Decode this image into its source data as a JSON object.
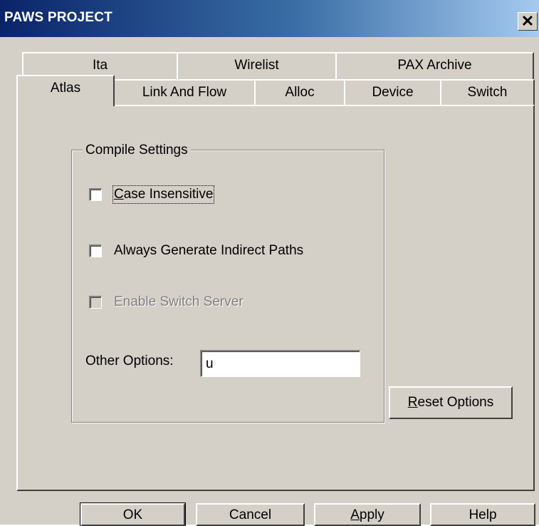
{
  "window": {
    "title": "PAWS PROJECT",
    "close_glyph": "✕",
    "close_icon": "close-icon"
  },
  "tabs": {
    "back_row": [
      "Ita",
      "Wirelist",
      "PAX Archive"
    ],
    "front_row": [
      "Atlas",
      "Link And Flow",
      "Alloc",
      "Device",
      "Switch"
    ],
    "active": "Atlas"
  },
  "compile_settings": {
    "legend": "Compile Settings",
    "case_insensitive": {
      "label": "Case Insensitive",
      "mnemonic": "C",
      "rest": "ase Insensitive",
      "checked": false
    },
    "always_generate": {
      "label": "Always Generate Indirect Paths",
      "checked": false
    },
    "enable_switch": {
      "label": "Enable Switch Server",
      "checked": false,
      "enabled": false
    },
    "other_options_label": "Other Options:",
    "other_options_value": "u"
  },
  "reset_button": {
    "label": "Reset Options",
    "mnemonic": "R",
    "rest": "eset Options"
  },
  "footer": {
    "ok": "OK",
    "cancel": "Cancel",
    "apply": {
      "label": "Apply",
      "mnemonic": "A",
      "rest": "pply"
    },
    "help": "Help"
  },
  "colors": {
    "face": "#d4d0c8",
    "titlebar_start": "#0a246a",
    "titlebar_end": "#a6caf0"
  }
}
